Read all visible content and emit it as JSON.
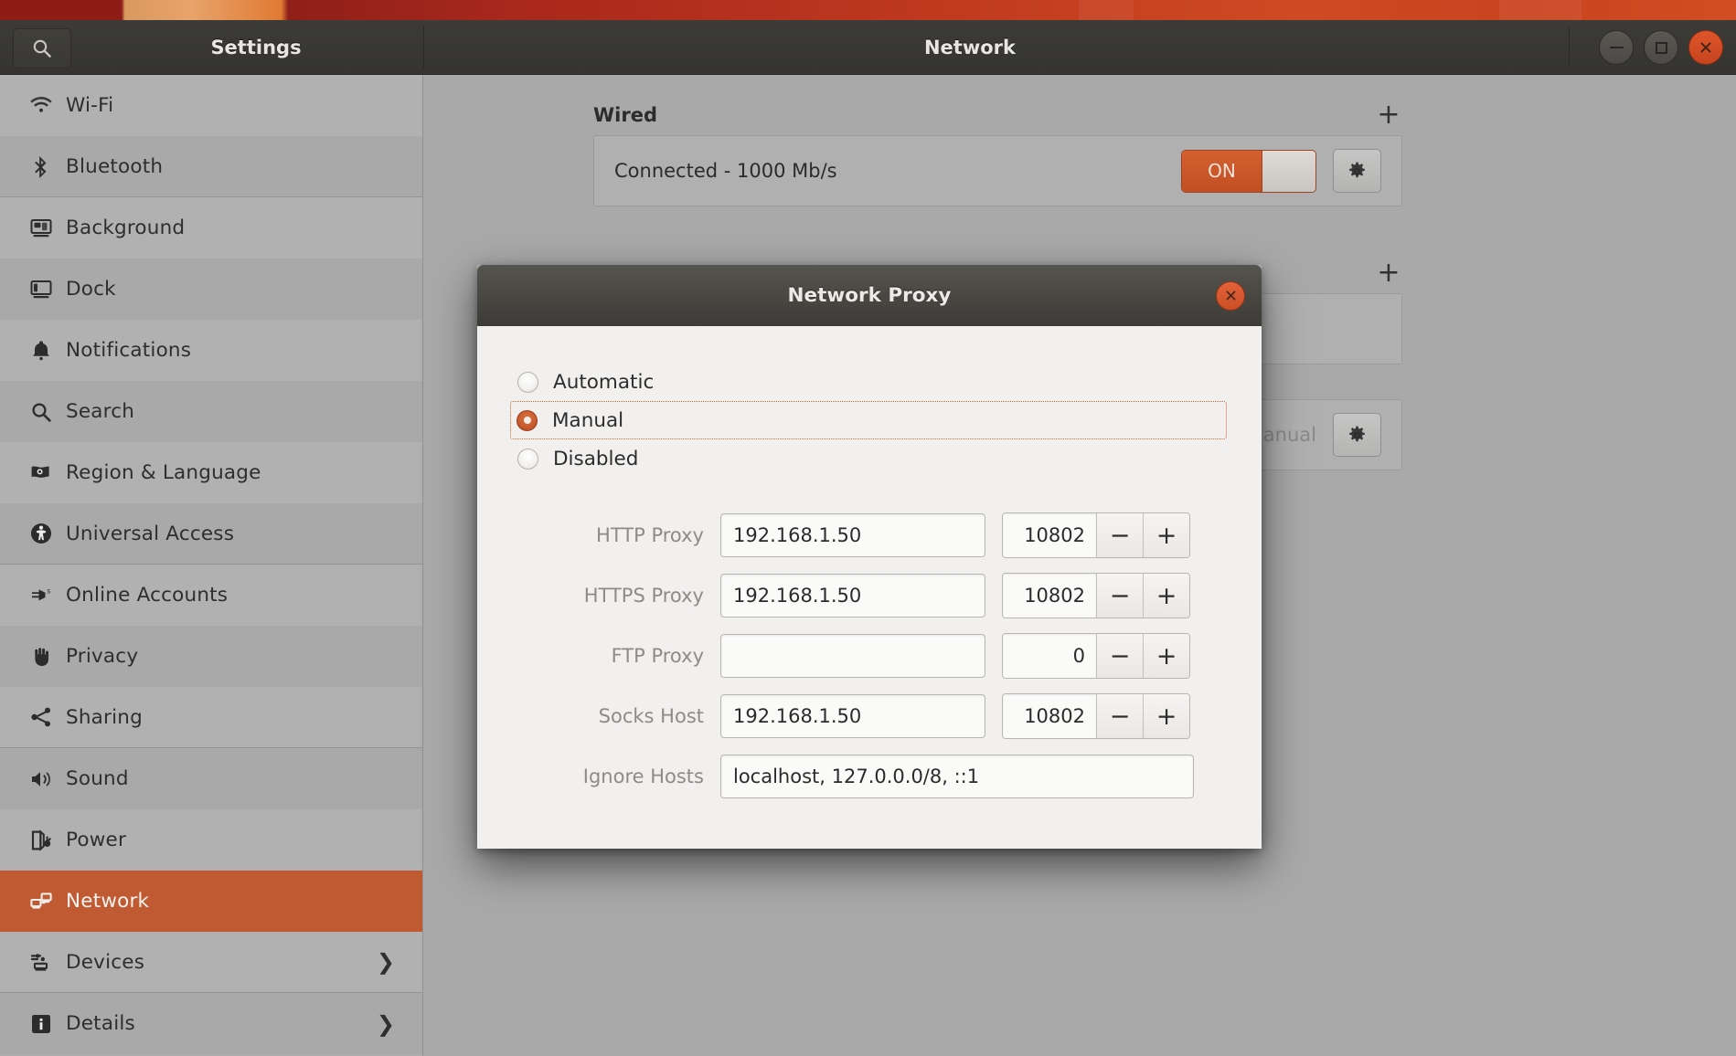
{
  "desktop": {
    "wallpaper_colors": [
      "#8e1d18",
      "#c13a1f",
      "#e07a33"
    ]
  },
  "header": {
    "sidebar_title": "Settings",
    "panel_title": "Network",
    "search_icon": "search-icon",
    "window_controls": [
      {
        "name": "minimize",
        "glyph": "–"
      },
      {
        "name": "maximize",
        "glyph": "□"
      },
      {
        "name": "close",
        "glyph": "✕"
      }
    ]
  },
  "sidebar": {
    "items": [
      {
        "label": "Wi-Fi",
        "icon": "wifi-icon",
        "selected": false,
        "chevron": false,
        "group_end": false
      },
      {
        "label": "Bluetooth",
        "icon": "bluetooth-icon",
        "selected": false,
        "chevron": false,
        "group_end": true
      },
      {
        "label": "Background",
        "icon": "background-icon",
        "selected": false,
        "chevron": false,
        "group_end": false
      },
      {
        "label": "Dock",
        "icon": "dock-icon",
        "selected": false,
        "chevron": false,
        "group_end": false
      },
      {
        "label": "Notifications",
        "icon": "bell-icon",
        "selected": false,
        "chevron": false,
        "group_end": false
      },
      {
        "label": "Search",
        "icon": "search-icon",
        "selected": false,
        "chevron": false,
        "group_end": false
      },
      {
        "label": "Region & Language",
        "icon": "flag-icon",
        "selected": false,
        "chevron": false,
        "group_end": false
      },
      {
        "label": "Universal Access",
        "icon": "accessibility-icon",
        "selected": false,
        "chevron": false,
        "group_end": true
      },
      {
        "label": "Online Accounts",
        "icon": "online-accounts-icon",
        "selected": false,
        "chevron": false,
        "group_end": false
      },
      {
        "label": "Privacy",
        "icon": "hand-icon",
        "selected": false,
        "chevron": false,
        "group_end": false
      },
      {
        "label": "Sharing",
        "icon": "share-icon",
        "selected": false,
        "chevron": false,
        "group_end": true
      },
      {
        "label": "Sound",
        "icon": "speaker-icon",
        "selected": false,
        "chevron": false,
        "group_end": false
      },
      {
        "label": "Power",
        "icon": "power-plug-icon",
        "selected": false,
        "chevron": false,
        "group_end": false
      },
      {
        "label": "Network",
        "icon": "network-icon",
        "selected": true,
        "chevron": false,
        "group_end": false
      },
      {
        "label": "Devices",
        "icon": "devices-icon",
        "selected": false,
        "chevron": true,
        "group_end": true
      },
      {
        "label": "Details",
        "icon": "info-icon",
        "selected": false,
        "chevron": true,
        "group_end": false
      }
    ]
  },
  "network_panel": {
    "wired": {
      "section_title": "Wired",
      "add_label": "+",
      "status": "Connected - 1000 Mb/s",
      "toggle_label": "ON",
      "toggle_state": "on",
      "gear_icon": "gear-icon"
    },
    "vpn": {
      "section_title": "",
      "add_label": "+",
      "status": ""
    },
    "proxy": {
      "section_title": "",
      "status": "Manual",
      "gear_icon": "gear-icon"
    }
  },
  "dialog": {
    "title": "Network Proxy",
    "close_glyph": "✕",
    "method_options": [
      {
        "label": "Automatic",
        "checked": false,
        "focused": false
      },
      {
        "label": "Manual",
        "checked": true,
        "focused": true
      },
      {
        "label": "Disabled",
        "checked": false,
        "focused": false
      }
    ],
    "fields": [
      {
        "label": "HTTP Proxy",
        "host": "192.168.1.50",
        "host_placeholder": "",
        "port": "10802",
        "has_port": true
      },
      {
        "label": "HTTPS Proxy",
        "host": "192.168.1.50",
        "host_placeholder": "",
        "port": "10802",
        "has_port": true
      },
      {
        "label": "FTP Proxy",
        "host": "",
        "host_placeholder": "",
        "port": "0",
        "has_port": true
      },
      {
        "label": "Socks Host",
        "host": "192.168.1.50",
        "host_placeholder": "",
        "port": "10802",
        "has_port": true
      }
    ],
    "ignore_hosts": {
      "label": "Ignore Hosts",
      "value": "localhost, 127.0.0.0/8, ::1",
      "placeholder": ""
    },
    "spin_minus": "−",
    "spin_plus": "+"
  },
  "colors": {
    "accent_orange": "#bf5a33",
    "toggle_on": "#c14f23",
    "close_button": "#cb4e25",
    "sidebar_bg": "#adadad",
    "content_bg": "#a9a9a9",
    "dialog_bg": "#f1f0ee",
    "titlebar_dark": "#3d3b37"
  }
}
